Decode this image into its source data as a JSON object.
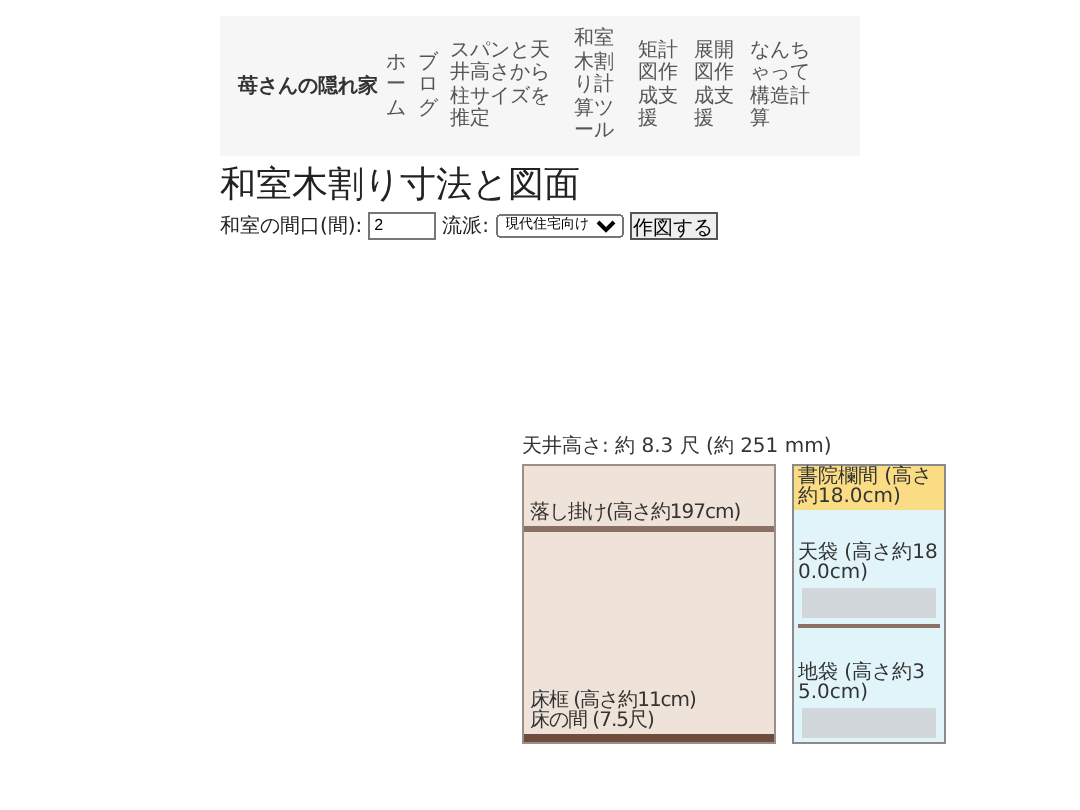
{
  "site_title": "苺さんの隠れ家",
  "nav": [
    {
      "label": "ホーム"
    },
    {
      "label": "ブログ"
    },
    {
      "label": "スパンと天井高さから柱サイズを推定"
    },
    {
      "label": "和室木割り計算ツール"
    },
    {
      "label": "矩計図作成支援"
    },
    {
      "label": "展開図作成支援"
    },
    {
      "label": "なんちゃって構造計算"
    }
  ],
  "page_title": "和室木割り寸法と図面",
  "form": {
    "width_label": "和室の間口(間):",
    "width_value": "2",
    "style_label": "流派:",
    "style_value": "現代住宅向け",
    "button": "作図する"
  },
  "drawing": {
    "caption": "天井高さ: 約 8.3 尺 (約 251 mm)",
    "alcove": {
      "top_label": "落し掛け(高さ約197cm)",
      "bottom_labels": [
        "床框 (高さ約11cm)",
        "床の間 (7.5尺)"
      ]
    },
    "cabinet": {
      "header": "書院欄間 (高さ約18.0cm)",
      "sections": [
        {
          "label": "天袋 (高さ約180.0cm)",
          "shelf": true
        },
        {
          "label": "地袋 (高さ約35.0cm)",
          "shelf": false
        }
      ]
    }
  }
}
